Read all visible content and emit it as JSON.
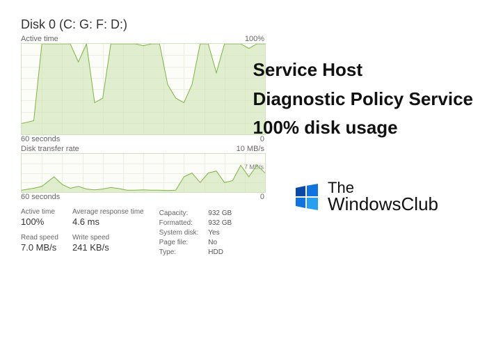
{
  "title": "Disk 0 (C: G: F: D:)",
  "chart_data": [
    {
      "type": "area",
      "name": "active_time",
      "label": "Active time",
      "ylabel_max": "100%",
      "xlabel": "60 seconds",
      "ylim": [
        0,
        100
      ],
      "xlim": [
        0,
        60
      ],
      "x": [
        0,
        3,
        5,
        8,
        10,
        12,
        14,
        16,
        18,
        20,
        22,
        24,
        26,
        28,
        30,
        32,
        34,
        36,
        38,
        40,
        42,
        44,
        46,
        48,
        50,
        52,
        54,
        56,
        58,
        60
      ],
      "values": [
        12,
        15,
        100,
        100,
        100,
        100,
        80,
        100,
        35,
        40,
        100,
        100,
        100,
        100,
        98,
        100,
        100,
        55,
        40,
        35,
        55,
        100,
        100,
        68,
        100,
        100,
        100,
        95,
        100,
        100
      ]
    },
    {
      "type": "area",
      "name": "disk_transfer_rate",
      "label": "Disk transfer rate",
      "ylabel_max": "10 MB/s",
      "ylabel_mid": "7 MB/s",
      "xlabel": "60 seconds",
      "ylim": [
        0,
        10
      ],
      "xlim": [
        0,
        60
      ],
      "x": [
        0,
        3,
        5,
        8,
        10,
        12,
        14,
        16,
        18,
        20,
        22,
        24,
        26,
        28,
        30,
        32,
        34,
        36,
        38,
        40,
        42,
        44,
        46,
        48,
        50,
        52,
        54,
        56,
        58,
        60
      ],
      "values": [
        0.5,
        1.0,
        1.5,
        4.0,
        2.0,
        1.0,
        1.5,
        0.8,
        0.6,
        0.8,
        1.2,
        0.9,
        0.5,
        0.5,
        0.6,
        0.5,
        0.5,
        0.4,
        0.5,
        4.0,
        5.0,
        2.5,
        5.0,
        5.5,
        2.5,
        3.0,
        7.0,
        4.0,
        7.0,
        5.0
      ]
    }
  ],
  "stats": {
    "active_time": {
      "label": "Active time",
      "value": "100%"
    },
    "avg_response": {
      "label": "Average response time",
      "value": "4.6 ms"
    },
    "read_speed": {
      "label": "Read speed",
      "value": "7.0 MB/s"
    },
    "write_speed": {
      "label": "Write speed",
      "value": "241 KB/s"
    }
  },
  "info": {
    "capacity": {
      "k": "Capacity:",
      "v": "932 GB"
    },
    "formatted": {
      "k": "Formatted:",
      "v": "932 GB"
    },
    "system_disk": {
      "k": "System disk:",
      "v": "Yes"
    },
    "page_file": {
      "k": "Page file:",
      "v": "No"
    },
    "type": {
      "k": "Type:",
      "v": "HDD"
    }
  },
  "overlay": {
    "l1": "Service Host",
    "l2": "Diagnostic Policy Service",
    "l3": "100% disk usage"
  },
  "logo": {
    "the": "The",
    "name": "WindowsClub"
  },
  "zero": "0"
}
